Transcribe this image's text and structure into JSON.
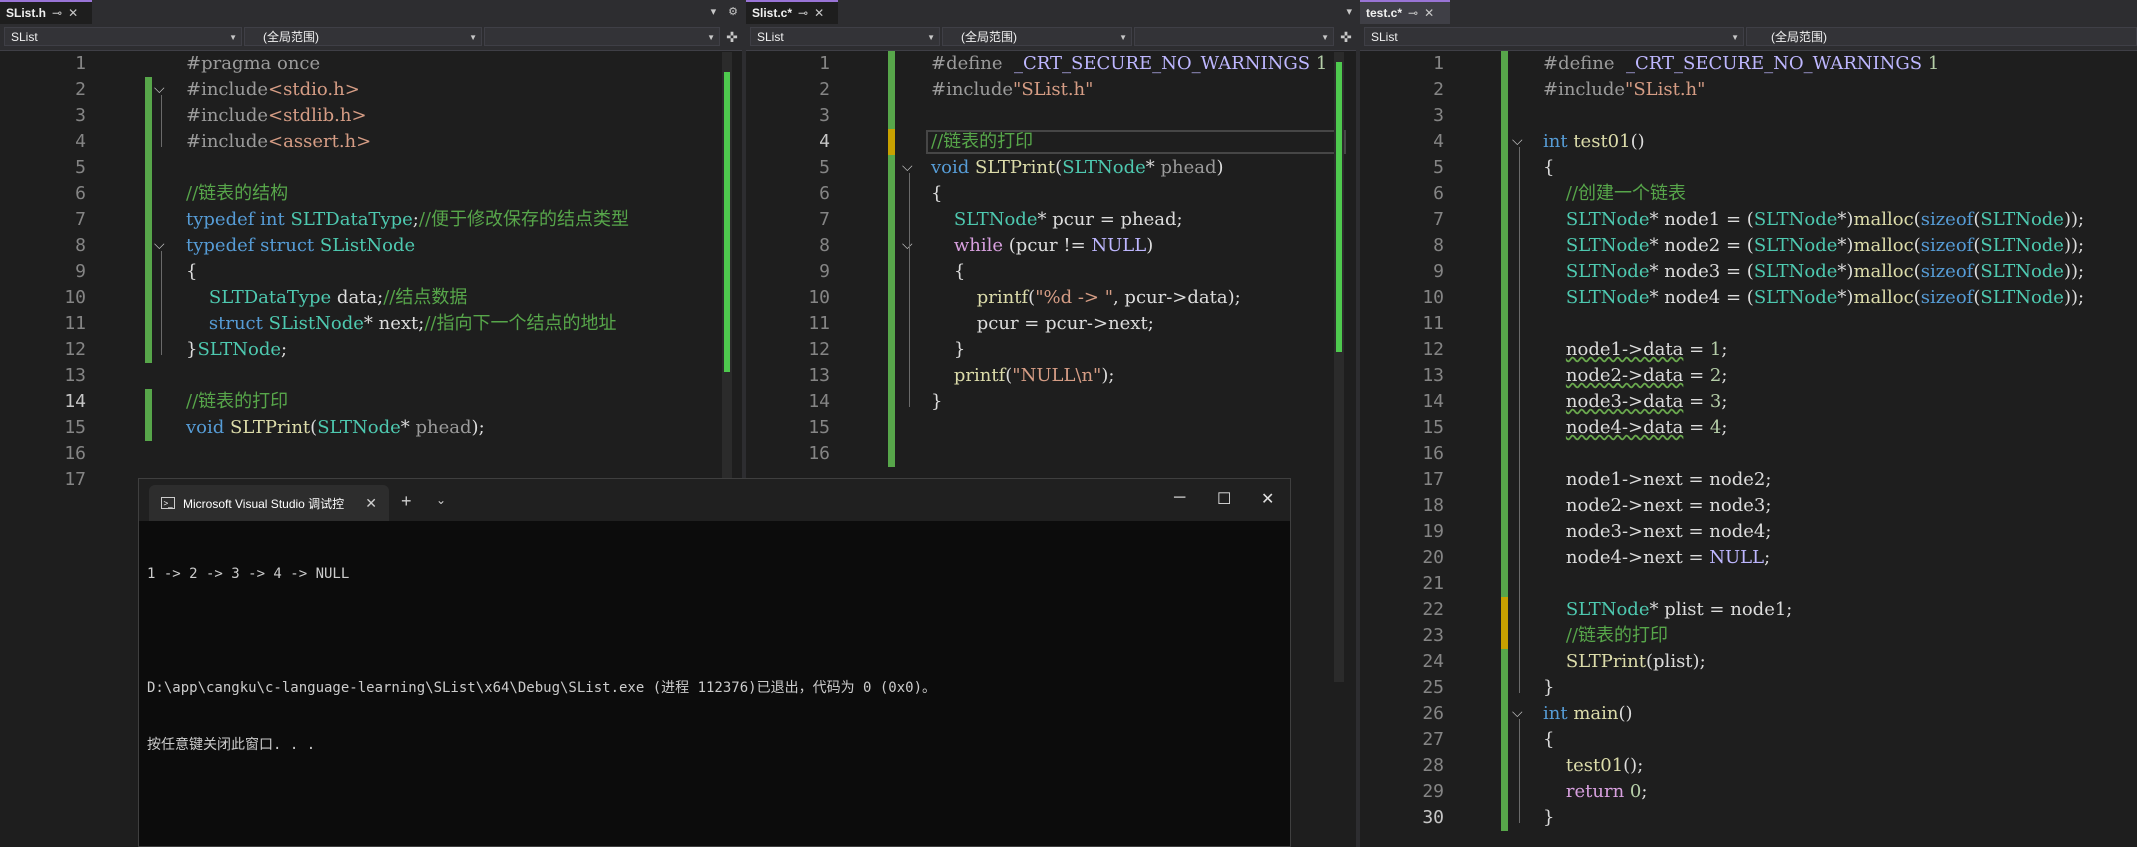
{
  "colors": {
    "editor_bg": "#1e1e1e",
    "tab_active_accent": "#9974d6",
    "change_bar": "#57a64a",
    "terminal_bg": "#0c0c0c"
  },
  "left_pane": {
    "tab_label": "SList.h",
    "project_combo": "SList",
    "scope_combo": "(全局范围)",
    "lines": [
      {
        "n": "1",
        "html": "<span class='pp'>#pragma once</span>"
      },
      {
        "n": "2",
        "html": "<span class='pp'>#include</span><span class='st'>&lt;stdio.h&gt;</span>"
      },
      {
        "n": "3",
        "html": "<span class='pp'>#include</span><span class='st'>&lt;stdlib.h&gt;</span>"
      },
      {
        "n": "4",
        "html": "<span class='pp'>#include</span><span class='st'>&lt;assert.h&gt;</span>"
      },
      {
        "n": "5",
        "html": ""
      },
      {
        "n": "6",
        "html": "<span class='cm'>//链表的结构</span>"
      },
      {
        "n": "7",
        "html": "<span class='kw'>typedef</span> <span class='kw'>int</span> <span class='ty'>SLTDataType</span>;<span class='cm'>//便于修改保存的结点类型</span>"
      },
      {
        "n": "8",
        "html": "<span class='kw'>typedef</span> <span class='kw'>struct</span> <span class='ty'>SListNode</span>"
      },
      {
        "n": "9",
        "html": "{"
      },
      {
        "n": "10",
        "html": "    <span class='ty'>SLTDataType</span> data;<span class='cm'>//结点数据</span>"
      },
      {
        "n": "11",
        "html": "    <span class='kw'>struct</span> <span class='ty'>SListNode</span>* next;<span class='cm'>//指向下一个结点的地址</span>"
      },
      {
        "n": "12",
        "html": "}<span class='ty'>SLTNode</span>;"
      },
      {
        "n": "13",
        "html": ""
      },
      {
        "n": "14",
        "html": "<span class='cm'>//链表的打印</span>"
      },
      {
        "n": "15",
        "html": "<span class='kw'>void</span> <span class='fn'>SLTPrint</span>(<span class='ty'>SLTNode</span>* <span class='pp'>phead</span>);"
      },
      {
        "n": "16",
        "html": ""
      },
      {
        "n": "17",
        "html": ""
      }
    ]
  },
  "mid_pane": {
    "tab_label": "Slist.c*",
    "project_combo": "SList",
    "scope_combo": "(全局范围)",
    "lines": [
      {
        "n": "1",
        "html": "<span class='pp'>#define</span>  <span class='mac'>_CRT_SECURE_NO_WARNINGS</span> <span class='nm'>1</span>"
      },
      {
        "n": "2",
        "html": "<span class='pp'>#include</span><span class='st'>\"SList.h\"</span>"
      },
      {
        "n": "3",
        "html": ""
      },
      {
        "n": "4",
        "html": "<span class='cm'>//链表的打印</span>"
      },
      {
        "n": "5",
        "html": "<span class='kw'>void</span> <span class='fn'>SLTPrint</span>(<span class='ty'>SLTNode</span>* <span class='pp'>phead</span>)"
      },
      {
        "n": "6",
        "html": "{"
      },
      {
        "n": "7",
        "html": "    <span class='ty'>SLTNode</span>* pcur = phead;"
      },
      {
        "n": "8",
        "html": "    <span class='kw2'>while</span> (pcur != <span class='mac'>NULL</span>)"
      },
      {
        "n": "9",
        "html": "    {"
      },
      {
        "n": "10",
        "html": "        <span class='fn'>printf</span>(<span class='st'>\"%d -&gt; \"</span>, pcur-&gt;data);"
      },
      {
        "n": "11",
        "html": "        pcur = pcur-&gt;next;"
      },
      {
        "n": "12",
        "html": "    }"
      },
      {
        "n": "13",
        "html": "    <span class='fn'>printf</span>(<span class='st'>\"NULL\\n\"</span>);"
      },
      {
        "n": "14",
        "html": "}"
      },
      {
        "n": "15",
        "html": ""
      },
      {
        "n": "16",
        "html": ""
      }
    ]
  },
  "right_pane": {
    "tab_label": "test.c*",
    "project_combo": "SList",
    "scope_combo": "(全局范围)",
    "lines": [
      {
        "n": "1",
        "html": "<span class='pp'>#define</span>  <span class='mac'>_CRT_SECURE_NO_WARNINGS</span> <span class='nm'>1</span>"
      },
      {
        "n": "2",
        "html": "<span class='pp'>#include</span><span class='st'>\"SList.h\"</span>"
      },
      {
        "n": "3",
        "html": ""
      },
      {
        "n": "4",
        "html": "<span class='kw'>int</span> <span class='fn'>test01</span>()"
      },
      {
        "n": "5",
        "html": "{"
      },
      {
        "n": "6",
        "html": "    <span class='cm'>//创建一个链表</span>"
      },
      {
        "n": "7",
        "html": "    <span class='ty'>SLTNode</span>* node1 = (<span class='ty'>SLTNode</span>*)<span class='fn'>malloc</span>(<span class='kw'>sizeof</span>(<span class='ty'>SLTNode</span>));"
      },
      {
        "n": "8",
        "html": "    <span class='ty'>SLTNode</span>* node2 = (<span class='ty'>SLTNode</span>*)<span class='fn'>malloc</span>(<span class='kw'>sizeof</span>(<span class='ty'>SLTNode</span>));"
      },
      {
        "n": "9",
        "html": "    <span class='ty'>SLTNode</span>* node3 = (<span class='ty'>SLTNode</span>*)<span class='fn'>malloc</span>(<span class='kw'>sizeof</span>(<span class='ty'>SLTNode</span>));"
      },
      {
        "n": "10",
        "html": "    <span class='ty'>SLTNode</span>* node4 = (<span class='ty'>SLTNode</span>*)<span class='fn'>malloc</span>(<span class='kw'>sizeof</span>(<span class='ty'>SLTNode</span>));"
      },
      {
        "n": "11",
        "html": ""
      },
      {
        "n": "12",
        "html": "    <span class='squig'>node1-&gt;data</span> = <span class='nm'>1</span>;"
      },
      {
        "n": "13",
        "html": "    <span class='squig'>node2-&gt;data</span> = <span class='nm'>2</span>;"
      },
      {
        "n": "14",
        "html": "    <span class='squig'>node3-&gt;data</span> = <span class='nm'>3</span>;"
      },
      {
        "n": "15",
        "html": "    <span class='squig'>node4-&gt;data</span> = <span class='nm'>4</span>;"
      },
      {
        "n": "16",
        "html": ""
      },
      {
        "n": "17",
        "html": "    node1-&gt;next = node2;"
      },
      {
        "n": "18",
        "html": "    node2-&gt;next = node3;"
      },
      {
        "n": "19",
        "html": "    node3-&gt;next = node4;"
      },
      {
        "n": "20",
        "html": "    node4-&gt;next = <span class='mac'>NULL</span>;"
      },
      {
        "n": "21",
        "html": ""
      },
      {
        "n": "22",
        "html": "    <span class='ty'>SLTNode</span>* plist = node1;"
      },
      {
        "n": "23",
        "html": "    <span class='cm'>//链表的打印</span>"
      },
      {
        "n": "24",
        "html": "    <span class='fn'>SLTPrint</span>(plist);"
      },
      {
        "n": "25",
        "html": "}"
      },
      {
        "n": "26",
        "html": "<span class='kw'>int</span> <span class='fn'>main</span>()"
      },
      {
        "n": "27",
        "html": "{"
      },
      {
        "n": "28",
        "html": "    <span class='fn'>test01</span>();"
      },
      {
        "n": "29",
        "html": "    <span class='kw2'>return</span> <span class='nm'>0</span>;"
      },
      {
        "n": "30",
        "html": "}"
      }
    ]
  },
  "terminal": {
    "tab_title": "Microsoft Visual Studio 调试控",
    "output_line1": "1 -> 2 -> 3 -> 4 -> NULL",
    "output_line2": "",
    "output_line3": "D:\\app\\cangku\\c-language-learning\\SList\\x64\\Debug\\SList.exe (进程 112376)已退出，代码为 0 (0x0)。",
    "output_line4": "按任意键关闭此窗口. . ."
  }
}
